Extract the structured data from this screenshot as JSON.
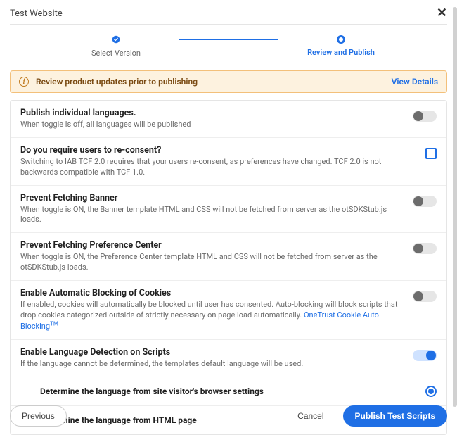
{
  "header": {
    "title": "Test Website"
  },
  "stepper": {
    "step1": "Select Version",
    "step2": "Review and Publish"
  },
  "alert": {
    "text": "Review product updates prior to publishing",
    "link": "View Details"
  },
  "settings": [
    {
      "key": "publish_lang",
      "title": "Publish individual languages.",
      "desc": "When toggle is off, all languages will be published",
      "control": "toggle",
      "on": false
    },
    {
      "key": "reconsent",
      "title": "Do you require users to re-consent?",
      "desc": "Switching to IAB TCF 2.0 requires that your users re-consent, as preferences have changed. TCF 2.0 is not backwards compatible with TCF 1.0.",
      "control": "checkbox",
      "on": false
    },
    {
      "key": "prevent_banner",
      "title": "Prevent Fetching Banner",
      "desc": "When toggle is ON, the Banner template HTML and CSS will not be fetched from server as the otSDKStub.js loads.",
      "control": "toggle",
      "on": false
    },
    {
      "key": "prevent_pref",
      "title": "Prevent Fetching Preference Center",
      "desc": "When toggle is ON, the Preference Center template HTML and CSS will not be fetched from server as the otSDKStub.js loads.",
      "control": "toggle",
      "on": false
    },
    {
      "key": "auto_block",
      "title": "Enable Automatic Blocking of Cookies",
      "desc": "If enabled, cookies will automatically be blocked until user has consented. Auto-blocking will block scripts that drop cookies categorized outside of strictly necessary on page load automatically. ",
      "link": "OneTrust Cookie Auto-Blocking",
      "sup": "TM",
      "control": "toggle",
      "on": false
    },
    {
      "key": "lang_detect",
      "title": "Enable Language Detection on Scripts",
      "desc": "If the language cannot be determined, the templates default language will be used.",
      "control": "toggle",
      "on": true
    }
  ],
  "lang_options": [
    {
      "key": "browser",
      "label": "Determine the language from site visitor's browser settings",
      "checked": true
    },
    {
      "key": "html",
      "label": "Determine the language from HTML page",
      "checked": false
    }
  ],
  "footer": {
    "previous": "Previous",
    "cancel": "Cancel",
    "publish": "Publish Test Scripts"
  }
}
